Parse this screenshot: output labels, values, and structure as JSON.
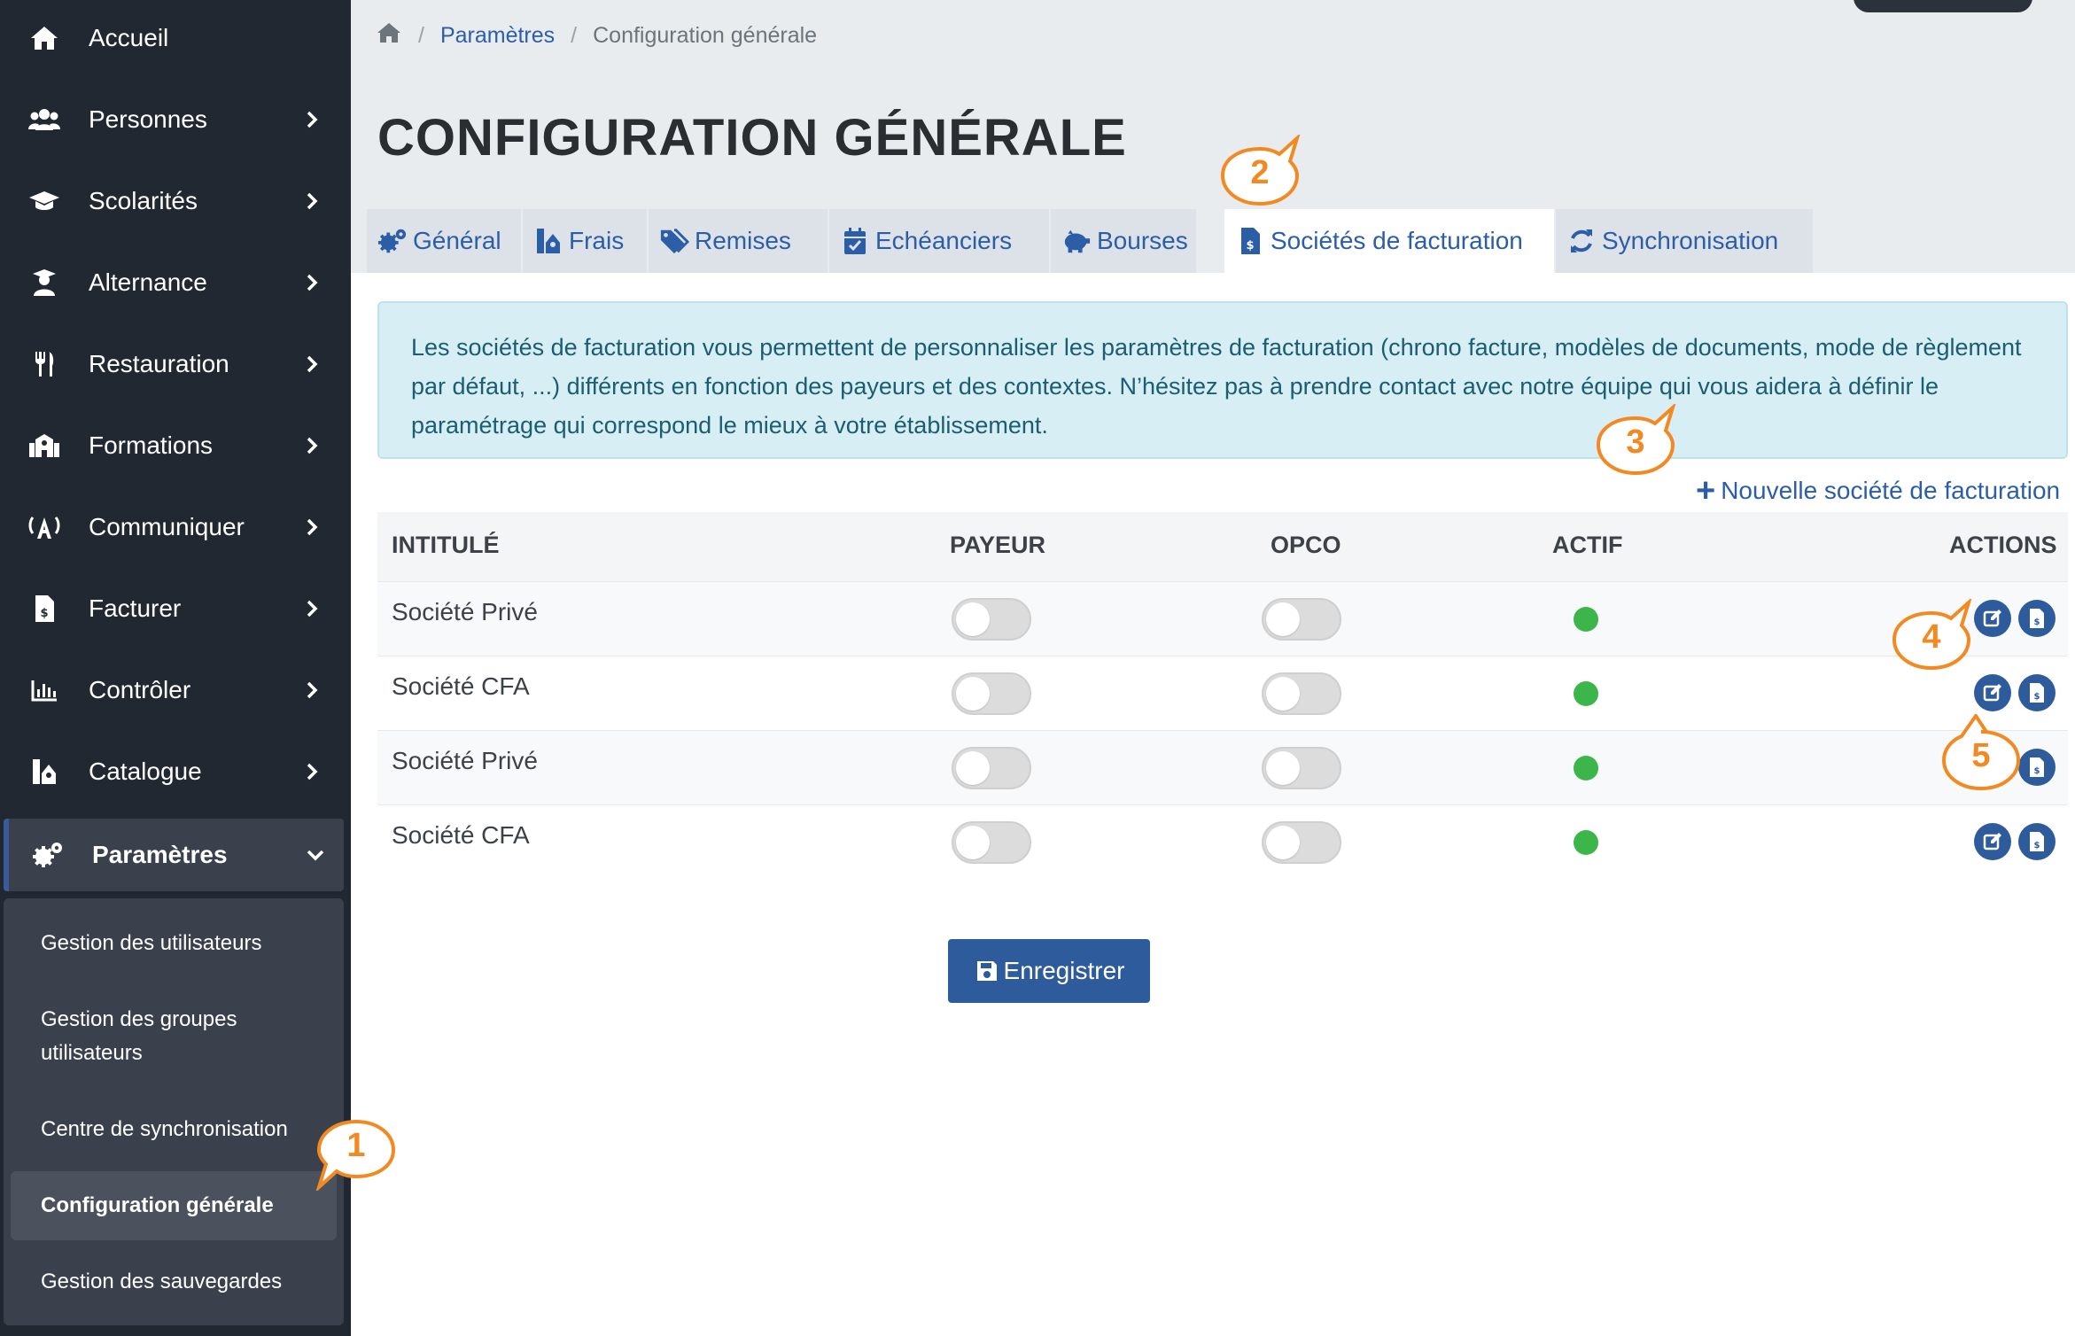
{
  "sidebar": {
    "items": [
      {
        "label": "Accueil",
        "icon": "home-icon"
      },
      {
        "label": "Personnes",
        "icon": "users-icon"
      },
      {
        "label": "Scolarités",
        "icon": "graduation-cap-icon"
      },
      {
        "label": "Alternance",
        "icon": "user-graduate-icon"
      },
      {
        "label": "Restauration",
        "icon": "utensils-icon"
      },
      {
        "label": "Formations",
        "icon": "school-icon"
      },
      {
        "label": "Communiquer",
        "icon": "broadcast-icon"
      },
      {
        "label": "Facturer",
        "icon": "invoice-icon"
      },
      {
        "label": "Contrôler",
        "icon": "chart-bar-icon"
      },
      {
        "label": "Catalogue",
        "icon": "catalog-icon"
      },
      {
        "label": "Paramètres",
        "icon": "cogs-icon"
      }
    ],
    "submenu": [
      {
        "label": "Gestion des utilisateurs"
      },
      {
        "label": "Gestion des groupes utilisateurs"
      },
      {
        "label": "Centre de synchronisation"
      },
      {
        "label": "Configuration générale"
      },
      {
        "label": "Gestion des sauvegardes"
      }
    ]
  },
  "breadcrumb": {
    "home_icon": "home-icon",
    "items": [
      "Paramètres",
      "Configuration générale"
    ],
    "separator": "/"
  },
  "page": {
    "title": "CONFIGURATION GÉNÉRALE"
  },
  "tabs": [
    {
      "label": "Général",
      "icon": "cogs-icon"
    },
    {
      "label": "Frais",
      "icon": "fees-icon"
    },
    {
      "label": "Remises",
      "icon": "tags-icon"
    },
    {
      "label": "Echéanciers",
      "icon": "calendar-check-icon"
    },
    {
      "label": "Bourses",
      "icon": "piggy-bank-icon"
    },
    {
      "label": "Sociétés de facturation",
      "icon": "invoice-icon",
      "active": true
    },
    {
      "label": "Synchronisation",
      "icon": "sync-icon"
    }
  ],
  "info": {
    "text": "Les sociétés de facturation vous permettent de personnaliser les paramètres de facturation (chrono facture, modèles de documents, mode de règlement par défaut, ...) différents en fonction des payeurs et des contextes. N’hésitez pas à prendre contact avec notre équipe qui vous aidera à définir le paramétrage qui correspond le mieux à votre établissement."
  },
  "actions": {
    "new_company_label": "Nouvelle société de facturation",
    "plus": "+",
    "save_label": "Enregistrer"
  },
  "table": {
    "headers": {
      "name": "INTITULÉ",
      "payer": "PAYEUR",
      "opco": "OPCO",
      "active": "ACTIF",
      "actions": "ACTIONS"
    },
    "rows": [
      {
        "name": "Société Privé",
        "payer": false,
        "opco": false,
        "active": true
      },
      {
        "name": "Société CFA",
        "payer": false,
        "opco": false,
        "active": true
      },
      {
        "name": "Société Privé",
        "payer": false,
        "opco": false,
        "active": true
      },
      {
        "name": "Société CFA",
        "payer": false,
        "opco": false,
        "active": true
      }
    ]
  },
  "callouts": [
    "1",
    "2",
    "3",
    "4",
    "5"
  ],
  "colors": {
    "sidebar_bg": "#222831",
    "accent": "#2d5b9c",
    "callout": "#f28a24",
    "active_dot": "#3cb54a",
    "info_bg": "#d7eef4"
  }
}
